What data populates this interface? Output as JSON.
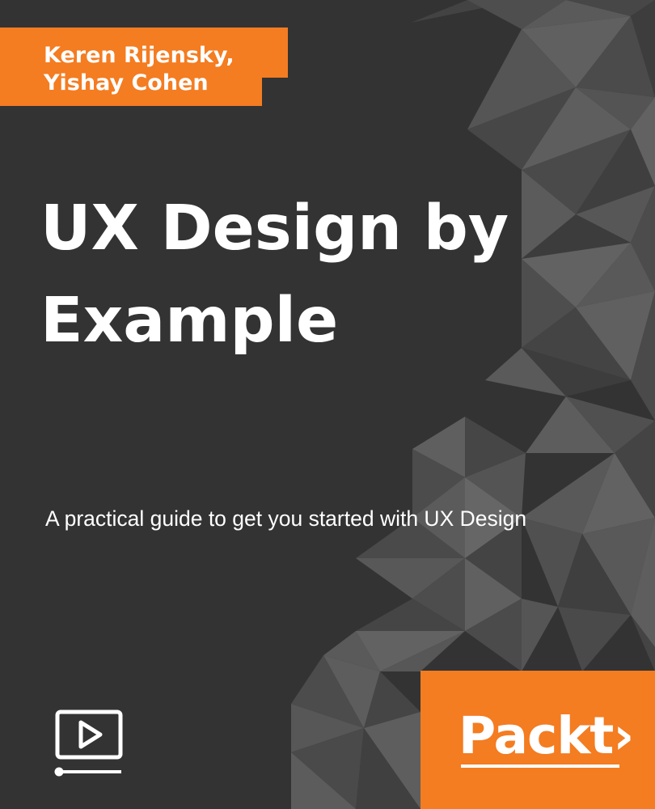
{
  "cover": {
    "authors": [
      "Keren Rijensky,",
      "Yishay Cohen"
    ],
    "title_lines": [
      "UX Design by",
      "Example"
    ],
    "subtitle": "A practical guide to get you started with UX Design",
    "publisher_logo": "Packt",
    "publisher_logo_arrow": "›",
    "media_icon": "video-play-icon",
    "colors": {
      "background": "#333333",
      "accent": "#F47C21",
      "text": "#FFFFFF",
      "triangle_light": "#5E5D5E",
      "triangle_mid": "#4A4A4A",
      "triangle_dark": "#3E3E3E"
    }
  }
}
